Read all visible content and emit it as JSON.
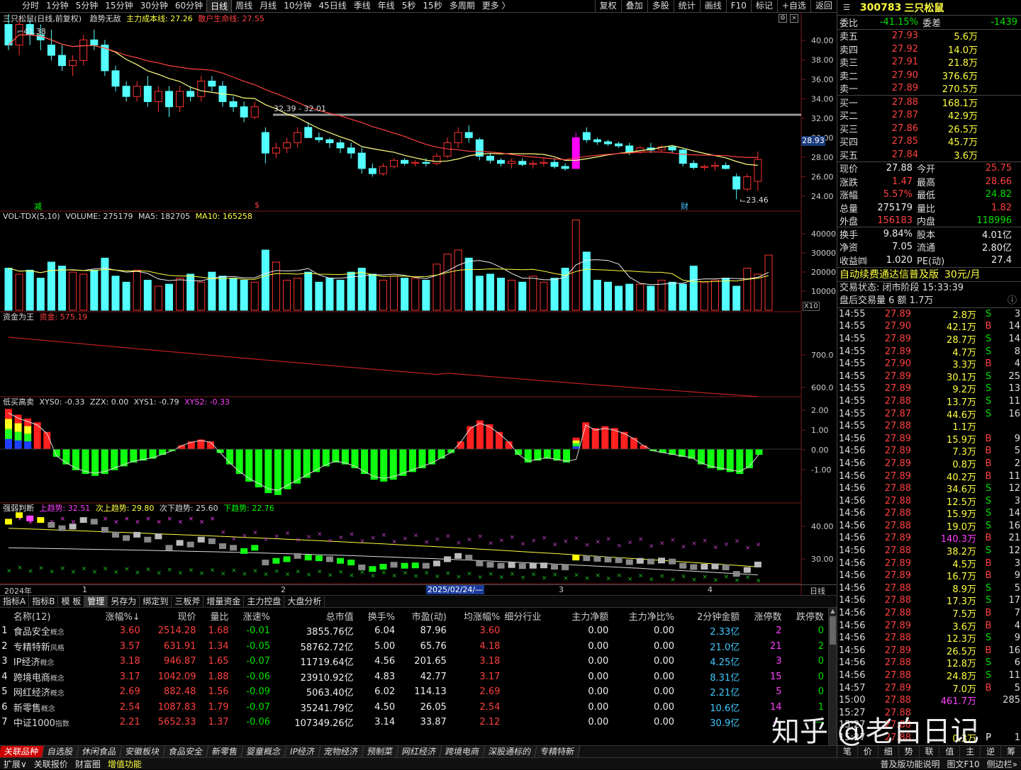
{
  "toolbar": {
    "periods": [
      "分时",
      "1分钟",
      "5分钟",
      "15分钟",
      "30分钟",
      "60分钟",
      "日线",
      "周线",
      "月线",
      "10分钟",
      "45日线",
      "季线",
      "年线",
      "5秒",
      "15秒",
      "多周期",
      "更多 〉"
    ],
    "active": "日线",
    "right": [
      "复权",
      "叠加",
      "多股",
      "统计",
      "画线",
      "F10",
      "标记",
      "+自选",
      "返回"
    ]
  },
  "main": {
    "name": "三只松鼠(日线,前复权)",
    "indicator": "趋势无敌",
    "cost_label": "主力成本线: 27.26",
    "life_label": "散户生命线: 27.55",
    "high_label": "41.38",
    "low_label": "23.46",
    "range_label": "32.39 - 32.01",
    "price_tag": "28.93",
    "marks": [
      "减",
      "$",
      "财"
    ],
    "yaxis": [
      "40.00",
      "38.00",
      "36.00",
      "34.00",
      "32.00",
      "30.00",
      "28.00",
      "26.00",
      "24.00"
    ]
  },
  "vol": {
    "header": "VOL-TDX(5,10)",
    "volume": "VOLUME: 275179",
    "ma5": "MA5: 182705",
    "ma10": "MA10: 165258",
    "yaxis": [
      "40000",
      "30000",
      "20000",
      "10000"
    ],
    "unit": "X10"
  },
  "fund": {
    "header": "资金为王",
    "val": "资金: 575.19",
    "yaxis": [
      "700.0",
      "600.0"
    ]
  },
  "dmgm": {
    "header": "低买高卖",
    "xys0": "XYS0: -0.33",
    "zzx": "ZZX: 0.00",
    "xys1": "XYS1: -0.79",
    "xys2": "XYS2: -0.33",
    "yaxis": [
      "2.00",
      "1.00",
      "0.00",
      "-1.00"
    ]
  },
  "qr": {
    "header": "强弱判断",
    "up": "上趋势: 32.51",
    "nup": "次上趋势: 29.80",
    "ndn": "次下趋势: 25.60",
    "dn": "下趋势: 22.76",
    "yaxis": [
      "40.00",
      "30.00"
    ]
  },
  "timeaxis": {
    "labels": [
      "2024年",
      "1",
      "2",
      "2025/02/24/—",
      "3",
      "4"
    ],
    "right": "日线"
  },
  "tabs": {
    "items": [
      "指标A",
      "指标B",
      "模 板",
      "管理",
      "另存为",
      "绑定到",
      "三板斧",
      "增量资金",
      "主力控盘",
      "大盘分析"
    ],
    "active": "管理"
  },
  "table": {
    "headers": [
      "",
      "名称(12)",
      "涨幅%↓",
      "现价",
      "量比",
      "涨速%",
      "总市值",
      "换手%",
      "市盈(动)",
      "均涨幅%",
      "细分行业",
      "主力净额",
      "主力净比%",
      "2分钟金额",
      "涨停数",
      "跌停数"
    ],
    "rows": [
      [
        "1",
        "食品安全",
        "概念",
        "3.60",
        "2514.28",
        "1.68",
        "-0.01",
        "3855.76亿",
        "6.04",
        "87.96",
        "3.60",
        "",
        "0.00",
        "0.00",
        "2.33亿",
        "2",
        "0"
      ],
      [
        "2",
        "专精特新",
        "风格",
        "3.57",
        "631.91",
        "1.34",
        "-0.05",
        "58762.72亿",
        "5.00",
        "65.76",
        "4.18",
        "",
        "0.00",
        "0.00",
        "21.0亿",
        "21",
        "2"
      ],
      [
        "3",
        "IP经济",
        "概念",
        "3.18",
        "946.87",
        "1.65",
        "-0.07",
        "11719.64亿",
        "4.56",
        "201.65",
        "3.18",
        "",
        "0.00",
        "0.00",
        "4.25亿",
        "3",
        "0"
      ],
      [
        "4",
        "跨境电商",
        "概念",
        "3.17",
        "1042.09",
        "1.88",
        "-0.06",
        "23910.92亿",
        "4.83",
        "42.77",
        "3.17",
        "",
        "0.00",
        "0.00",
        "8.31亿",
        "15",
        "0"
      ],
      [
        "5",
        "网红经济",
        "概念",
        "2.69",
        "882.48",
        "1.56",
        "-0.09",
        "5063.40亿",
        "6.02",
        "114.13",
        "2.69",
        "",
        "0.00",
        "0.00",
        "2.21亿",
        "5",
        "0"
      ],
      [
        "6",
        "新零售",
        "概念",
        "2.54",
        "1087.83",
        "1.79",
        "-0.07",
        "35241.79亿",
        "4.50",
        "26.05",
        "2.54",
        "",
        "0.00",
        "0.00",
        "10.6亿",
        "14",
        "1"
      ],
      [
        "7",
        "中证1000",
        "指数",
        "2.21",
        "5652.33",
        "1.37",
        "-0.06",
        "107349.26亿",
        "3.14",
        "33.87",
        "2.12",
        "",
        "0.00",
        "0.00",
        "30.9亿",
        "—",
        "—"
      ]
    ]
  },
  "sectors": {
    "items": [
      "关联品种",
      "自选股",
      "休闲食品",
      "安徽板块",
      "食品安全",
      "新零售",
      "婴童概念",
      "IP经济",
      "宠物经济",
      "预制菜",
      "网红经济",
      "跨境电商",
      "深股通标的",
      "专精特新"
    ],
    "active": "关联品种"
  },
  "status": {
    "items": [
      "扩展∨",
      "关联报价",
      "财富圈",
      "增值功能"
    ],
    "right": [
      "普及版功能说明",
      "图文F10",
      "侧边栏»"
    ]
  },
  "quote": {
    "code": "300783",
    "name": "三只松鼠",
    "wb_label": "委比",
    "wb": "-41.15%",
    "wc_label": "委差",
    "wc": "-1439",
    "sells": [
      [
        "卖五",
        "27.93",
        "5.6万"
      ],
      [
        "卖四",
        "27.92",
        "14.0万"
      ],
      [
        "卖三",
        "27.91",
        "21.8万"
      ],
      [
        "卖二",
        "27.90",
        "376.6万"
      ],
      [
        "卖一",
        "27.89",
        "270.5万"
      ]
    ],
    "buys": [
      [
        "买一",
        "27.88",
        "168.1万"
      ],
      [
        "买二",
        "27.87",
        "42.9万"
      ],
      [
        "买三",
        "27.86",
        "26.5万"
      ],
      [
        "买四",
        "27.85",
        "45.7万"
      ],
      [
        "买五",
        "27.84",
        "3.6万"
      ]
    ],
    "stats": [
      [
        "现价",
        "27.88",
        "今开",
        "25.75"
      ],
      [
        "涨跌",
        "1.47",
        "最高",
        "28.66"
      ],
      [
        "涨幅",
        "5.57%",
        "最低",
        "24.82"
      ],
      [
        "总量",
        "275179",
        "量比",
        "1.82"
      ],
      [
        "外盘",
        "156183",
        "内盘",
        "118996"
      ],
      [
        "换手",
        "9.84%",
        "股本",
        "4.01亿"
      ],
      [
        "净资",
        "7.05",
        "流通",
        "2.80亿"
      ],
      [
        "收益㈣",
        "1.020",
        "PE(动)",
        "27.4"
      ]
    ],
    "ad": "自动续费通达信普及版",
    "ad_price": "30元/月",
    "state": "交易状态: 闭市阶段 15:33:39",
    "after": "盘后交易量 6 额 1.7万",
    "ticks": [
      [
        "14:55",
        "27.89",
        "2.8万",
        "S",
        "3"
      ],
      [
        "14:55",
        "27.90",
        "42.1万",
        "B",
        "14"
      ],
      [
        "14:55",
        "27.89",
        "28.7万",
        "S",
        "14"
      ],
      [
        "14:55",
        "27.89",
        "4.7万",
        "S",
        "8"
      ],
      [
        "14:55",
        "27.90",
        "3.3万",
        "B",
        "4"
      ],
      [
        "14:55",
        "27.89",
        "30.1万",
        "S",
        "25"
      ],
      [
        "14:55",
        "27.89",
        "9.2万",
        "S",
        "13"
      ],
      [
        "14:55",
        "27.88",
        "13.7万",
        "S",
        "11"
      ],
      [
        "14:55",
        "27.87",
        "44.6万",
        "S",
        "16"
      ],
      [
        "14:55",
        "27.88",
        "1.1万",
        "",
        ""
      ],
      [
        "14:56",
        "27.89",
        "15.9万",
        "B",
        "9"
      ],
      [
        "14:56",
        "27.89",
        "7.3万",
        "B",
        "5"
      ],
      [
        "14:56",
        "27.89",
        "0.8万",
        "B",
        "2"
      ],
      [
        "14:56",
        "27.89",
        "40.2万",
        "B",
        "11"
      ],
      [
        "14:56",
        "27.88",
        "34.6万",
        "S",
        "12"
      ],
      [
        "14:56",
        "27.88",
        "12.5万",
        "S",
        "3"
      ],
      [
        "14:56",
        "27.88",
        "15.9万",
        "S",
        "14"
      ],
      [
        "14:56",
        "27.88",
        "19.0万",
        "S",
        "16"
      ],
      [
        "14:56",
        "27.89",
        "140.3万",
        "B",
        "21"
      ],
      [
        "14:56",
        "27.88",
        "38.2万",
        "S",
        "12"
      ],
      [
        "14:56",
        "27.89",
        "4.5万",
        "B",
        "3"
      ],
      [
        "14:56",
        "27.89",
        "16.7万",
        "B",
        "9"
      ],
      [
        "14:56",
        "27.88",
        "8.9万",
        "S",
        "5"
      ],
      [
        "14:56",
        "27.88",
        "17.3万",
        "S",
        "17"
      ],
      [
        "14:56",
        "27.88",
        "7.5万",
        "B",
        "7"
      ],
      [
        "14:56",
        "27.89",
        "3.6万",
        "B",
        "4"
      ],
      [
        "14:56",
        "27.88",
        "12.3万",
        "S",
        "9"
      ],
      [
        "14:56",
        "27.89",
        "26.5万",
        "B",
        "16"
      ],
      [
        "14:56",
        "27.88",
        "12.8万",
        "S",
        "6"
      ],
      [
        "14:56",
        "27.88",
        "24.8万",
        "S",
        "11"
      ],
      [
        "14:57",
        "27.89",
        "7.0万",
        "B",
        "5"
      ],
      [
        "15:00",
        "27.88",
        "461.7万",
        "",
        "285"
      ],
      [
        "15:27",
        "27.88",
        "",
        "",
        ""
      ],
      [
        "15:27",
        "27.88",
        "",
        "",
        ""
      ],
      [
        "15:27",
        "27.88",
        "0.3万",
        "P",
        "1"
      ]
    ],
    "bottom": [
      "笔",
      "价",
      "细",
      "势",
      "联",
      "值",
      "主",
      "逆",
      "筹"
    ]
  },
  "watermark": "知乎 @老白日记",
  "colors": {
    "up": "#ff3030",
    "down": "#40e8ff",
    "green": "#00ff00",
    "yellow": "#ffff40",
    "magenta": "#ff40ff"
  },
  "chart_data": {
    "type": "candlestick",
    "series": [
      {
        "o": 41,
        "h": 42,
        "l": 38.5,
        "c": 39
      },
      {
        "o": 39,
        "h": 41.5,
        "l": 38,
        "c": 41
      },
      {
        "o": 41,
        "h": 41.4,
        "l": 39,
        "c": 40
      },
      {
        "o": 40,
        "h": 41,
        "l": 38.5,
        "c": 39.5
      },
      {
        "o": 39,
        "h": 40.5,
        "l": 37.5,
        "c": 38
      },
      {
        "o": 38,
        "h": 39,
        "l": 36.5,
        "c": 37
      },
      {
        "o": 37,
        "h": 38,
        "l": 36,
        "c": 37.5
      },
      {
        "o": 37.5,
        "h": 40,
        "l": 37,
        "c": 39.5
      },
      {
        "o": 39.5,
        "h": 40.5,
        "l": 38.5,
        "c": 39
      },
      {
        "o": 39,
        "h": 39.5,
        "l": 36,
        "c": 36.5
      },
      {
        "o": 36.5,
        "h": 37,
        "l": 34.5,
        "c": 35
      },
      {
        "o": 35,
        "h": 35.5,
        "l": 33.5,
        "c": 34
      },
      {
        "o": 34,
        "h": 35.5,
        "l": 33.5,
        "c": 35
      },
      {
        "o": 35,
        "h": 36,
        "l": 33,
        "c": 33.5
      },
      {
        "o": 33.5,
        "h": 35,
        "l": 32.5,
        "c": 34.5
      },
      {
        "o": 34.5,
        "h": 35,
        "l": 32,
        "c": 33
      },
      {
        "o": 33,
        "h": 35,
        "l": 32.5,
        "c": 34.5
      },
      {
        "o": 34.5,
        "h": 35,
        "l": 33.5,
        "c": 34
      },
      {
        "o": 34,
        "h": 36,
        "l": 33.5,
        "c": 35.5
      },
      {
        "o": 35.5,
        "h": 36,
        "l": 34.5,
        "c": 35
      },
      {
        "o": 35,
        "h": 35.5,
        "l": 33,
        "c": 33.5
      },
      {
        "o": 33.5,
        "h": 34,
        "l": 32.5,
        "c": 33
      },
      {
        "o": 33,
        "h": 33.5,
        "l": 31.5,
        "c": 32
      },
      {
        "o": 32,
        "h": 33.5,
        "l": 31.8,
        "c": 33
      },
      {
        "o": 30.5,
        "h": 31,
        "l": 27.5,
        "c": 28.5
      },
      {
        "o": 28.5,
        "h": 29.5,
        "l": 28,
        "c": 29
      },
      {
        "o": 29,
        "h": 30,
        "l": 28.5,
        "c": 29.5
      },
      {
        "o": 29.5,
        "h": 31,
        "l": 29,
        "c": 30.5
      },
      {
        "o": 31,
        "h": 31.5,
        "l": 30,
        "c": 30
      },
      {
        "o": 30,
        "h": 30.5,
        "l": 29.5,
        "c": 29.8
      },
      {
        "o": 29.8,
        "h": 30,
        "l": 29,
        "c": 29.5
      },
      {
        "o": 29.5,
        "h": 29.8,
        "l": 28.5,
        "c": 29
      },
      {
        "o": 29,
        "h": 29.5,
        "l": 28,
        "c": 28.5
      },
      {
        "o": 28.5,
        "h": 29,
        "l": 26.5,
        "c": 27
      },
      {
        "o": 27,
        "h": 27.5,
        "l": 26.2,
        "c": 26.5
      },
      {
        "o": 26.5,
        "h": 27.5,
        "l": 26.3,
        "c": 27.2
      },
      {
        "o": 27.2,
        "h": 28,
        "l": 27,
        "c": 27.8
      },
      {
        "o": 27.8,
        "h": 28,
        "l": 27.3,
        "c": 27.5
      },
      {
        "o": 27.5,
        "h": 27.8,
        "l": 27.2,
        "c": 27.6
      },
      {
        "o": 27.6,
        "h": 28,
        "l": 27.2,
        "c": 27.5
      },
      {
        "o": 27.5,
        "h": 28.5,
        "l": 27.3,
        "c": 28.2
      },
      {
        "o": 28.2,
        "h": 30,
        "l": 28,
        "c": 29.5
      },
      {
        "o": 29.5,
        "h": 31,
        "l": 29,
        "c": 30.5
      },
      {
        "o": 30.5,
        "h": 31.2,
        "l": 29.5,
        "c": 30
      },
      {
        "o": 29.8,
        "h": 30,
        "l": 27.8,
        "c": 28.2
      },
      {
        "o": 28.2,
        "h": 28.5,
        "l": 27.5,
        "c": 27.8
      },
      {
        "o": 27.8,
        "h": 28,
        "l": 27.2,
        "c": 27.5
      },
      {
        "o": 27.5,
        "h": 28,
        "l": 27,
        "c": 27.7
      },
      {
        "o": 27.7,
        "h": 28,
        "l": 27.2,
        "c": 27.4
      },
      {
        "o": 27.4,
        "h": 27.8,
        "l": 27,
        "c": 27.5
      },
      {
        "o": 27.5,
        "h": 28,
        "l": 27.2,
        "c": 27.6
      },
      {
        "o": 27.6,
        "h": 28,
        "l": 27,
        "c": 27.2
      },
      {
        "o": 27.2,
        "h": 27.5,
        "l": 26.8,
        "c": 27
      },
      {
        "o": 27,
        "h": 30.5,
        "l": 27,
        "c": 30
      },
      {
        "o": 30.5,
        "h": 31,
        "l": 29.5,
        "c": 29.8
      },
      {
        "o": 29.8,
        "h": 30,
        "l": 29.3,
        "c": 29.6
      },
      {
        "o": 29.6,
        "h": 29.8,
        "l": 29.2,
        "c": 29.4
      },
      {
        "o": 29.4,
        "h": 29.6,
        "l": 29,
        "c": 29.2
      },
      {
        "o": 29.2,
        "h": 29.5,
        "l": 28.3,
        "c": 28.6
      },
      {
        "o": 28.6,
        "h": 29.2,
        "l": 28.4,
        "c": 29
      },
      {
        "o": 29,
        "h": 29.5,
        "l": 28.5,
        "c": 28.8
      },
      {
        "o": 28.8,
        "h": 29.3,
        "l": 28.6,
        "c": 29.1
      },
      {
        "o": 29.1,
        "h": 29.3,
        "l": 28.5,
        "c": 28.8
      },
      {
        "o": 28.8,
        "h": 28.9,
        "l": 27.2,
        "c": 27.5
      },
      {
        "o": 27.5,
        "h": 27.8,
        "l": 26.9,
        "c": 27.1
      },
      {
        "o": 27.1,
        "h": 27.4,
        "l": 26.8,
        "c": 27.2
      },
      {
        "o": 27.2,
        "h": 27.7,
        "l": 26.8,
        "c": 27.3
      },
      {
        "o": 27.3,
        "h": 27.6,
        "l": 26.9,
        "c": 27
      },
      {
        "o": 26.2,
        "h": 26.5,
        "l": 24,
        "c": 25
      },
      {
        "o": 25,
        "h": 26.5,
        "l": 24.8,
        "c": 26.2
      },
      {
        "o": 25.75,
        "h": 28.66,
        "l": 24.82,
        "c": 27.88
      }
    ],
    "vol": [
      21,
      18,
      20,
      16,
      24,
      22,
      19,
      18,
      20,
      26,
      17,
      14,
      20,
      15,
      12,
      13,
      16,
      18,
      14,
      19,
      17,
      16,
      15,
      14,
      30,
      24,
      15,
      16,
      19,
      14,
      16,
      15,
      19,
      21,
      18,
      15,
      17,
      16,
      16,
      15,
      23,
      28,
      30,
      26,
      17,
      18,
      16,
      15,
      14,
      17,
      14,
      16,
      21,
      45,
      29,
      15,
      14,
      12,
      13,
      13,
      12,
      15,
      14,
      13,
      22,
      14,
      15,
      16,
      12,
      21,
      18,
      27.5
    ],
    "vol_up": [
      false,
      true,
      false,
      false,
      false,
      false,
      true,
      true,
      false,
      false,
      false,
      false,
      true,
      false,
      true,
      false,
      true,
      false,
      true,
      false,
      false,
      false,
      false,
      true,
      false,
      true,
      true,
      true,
      false,
      false,
      false,
      false,
      false,
      false,
      false,
      true,
      true,
      false,
      true,
      false,
      true,
      true,
      true,
      false,
      false,
      false,
      false,
      true,
      false,
      true,
      true,
      false,
      false,
      true,
      false,
      false,
      false,
      false,
      false,
      true,
      false,
      true,
      false,
      false,
      false,
      true,
      true,
      false,
      false,
      true,
      true,
      true
    ],
    "ylim": [
      23,
      42
    ]
  }
}
